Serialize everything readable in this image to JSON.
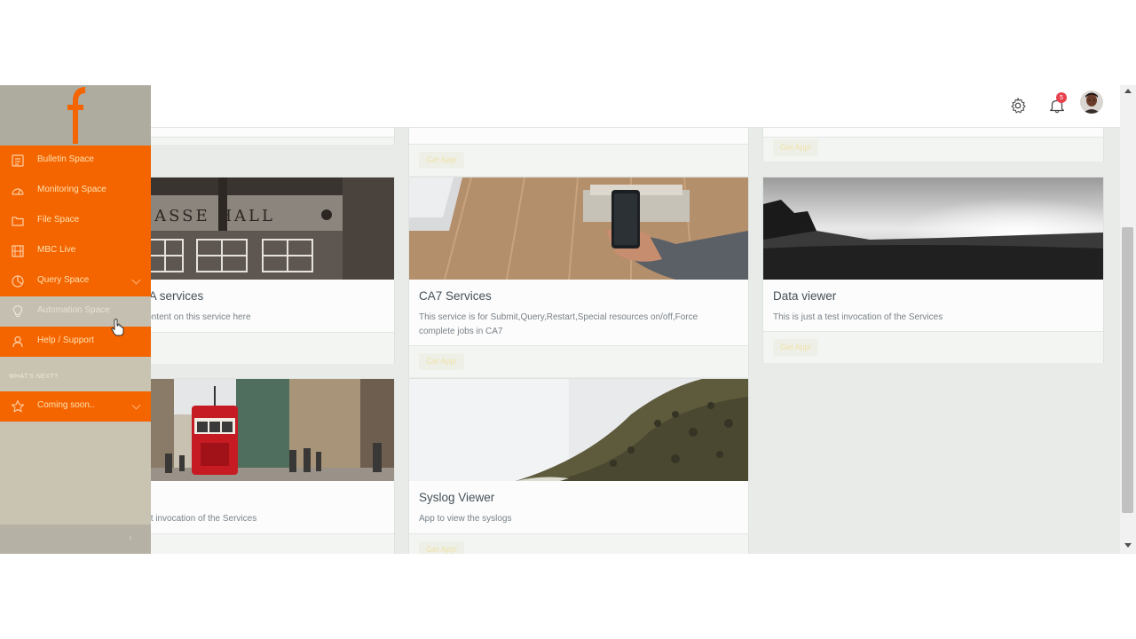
{
  "header": {
    "notification_count": "5"
  },
  "sidebar": {
    "items": [
      {
        "label": "Bulletin Space",
        "icon": "bulletin-icon"
      },
      {
        "label": "Monitoring Space",
        "icon": "dashboard-icon"
      },
      {
        "label": "File Space",
        "icon": "folder-icon"
      },
      {
        "label": "MBC Live",
        "icon": "film-icon"
      },
      {
        "label": "Query Space",
        "icon": "pie-chart-icon"
      },
      {
        "label": "Automation Space",
        "icon": "lightbulb-icon"
      },
      {
        "label": "Help / Support",
        "icon": "support-icon"
      }
    ],
    "section_label": "WHAT'S NEXT?",
    "coming_soon": {
      "label": "Coming soon..",
      "icon": "star-icon"
    },
    "collapse_arrow": "›"
  },
  "cards": {
    "top_middle_button": "Get App!",
    "top_right_button": "Get App!",
    "ca_services": {
      "title": "CA services",
      "desc": "Content on this service here"
    },
    "ca7_services": {
      "title": "CA7 Services",
      "desc": "This service is for Submit,Query,Restart,Special resources on/off,Force complete jobs in CA7",
      "button": "Get App!"
    },
    "data_viewer": {
      "title": "Data viewer",
      "desc": "This is just a test invocation of the Services",
      "button": "Get App!"
    },
    "tram_card": {
      "title": "",
      "desc": "This is just a test invocation of the Services"
    },
    "syslog_viewer": {
      "title": "Syslog Viewer",
      "desc": "App to view the syslogs",
      "button": "Get App!"
    }
  },
  "colors": {
    "sidebar_accent": "#f46500",
    "sidebar_background": "#c9c3b2",
    "content_background": "#e8ebe8",
    "badge": "#e8414d"
  }
}
